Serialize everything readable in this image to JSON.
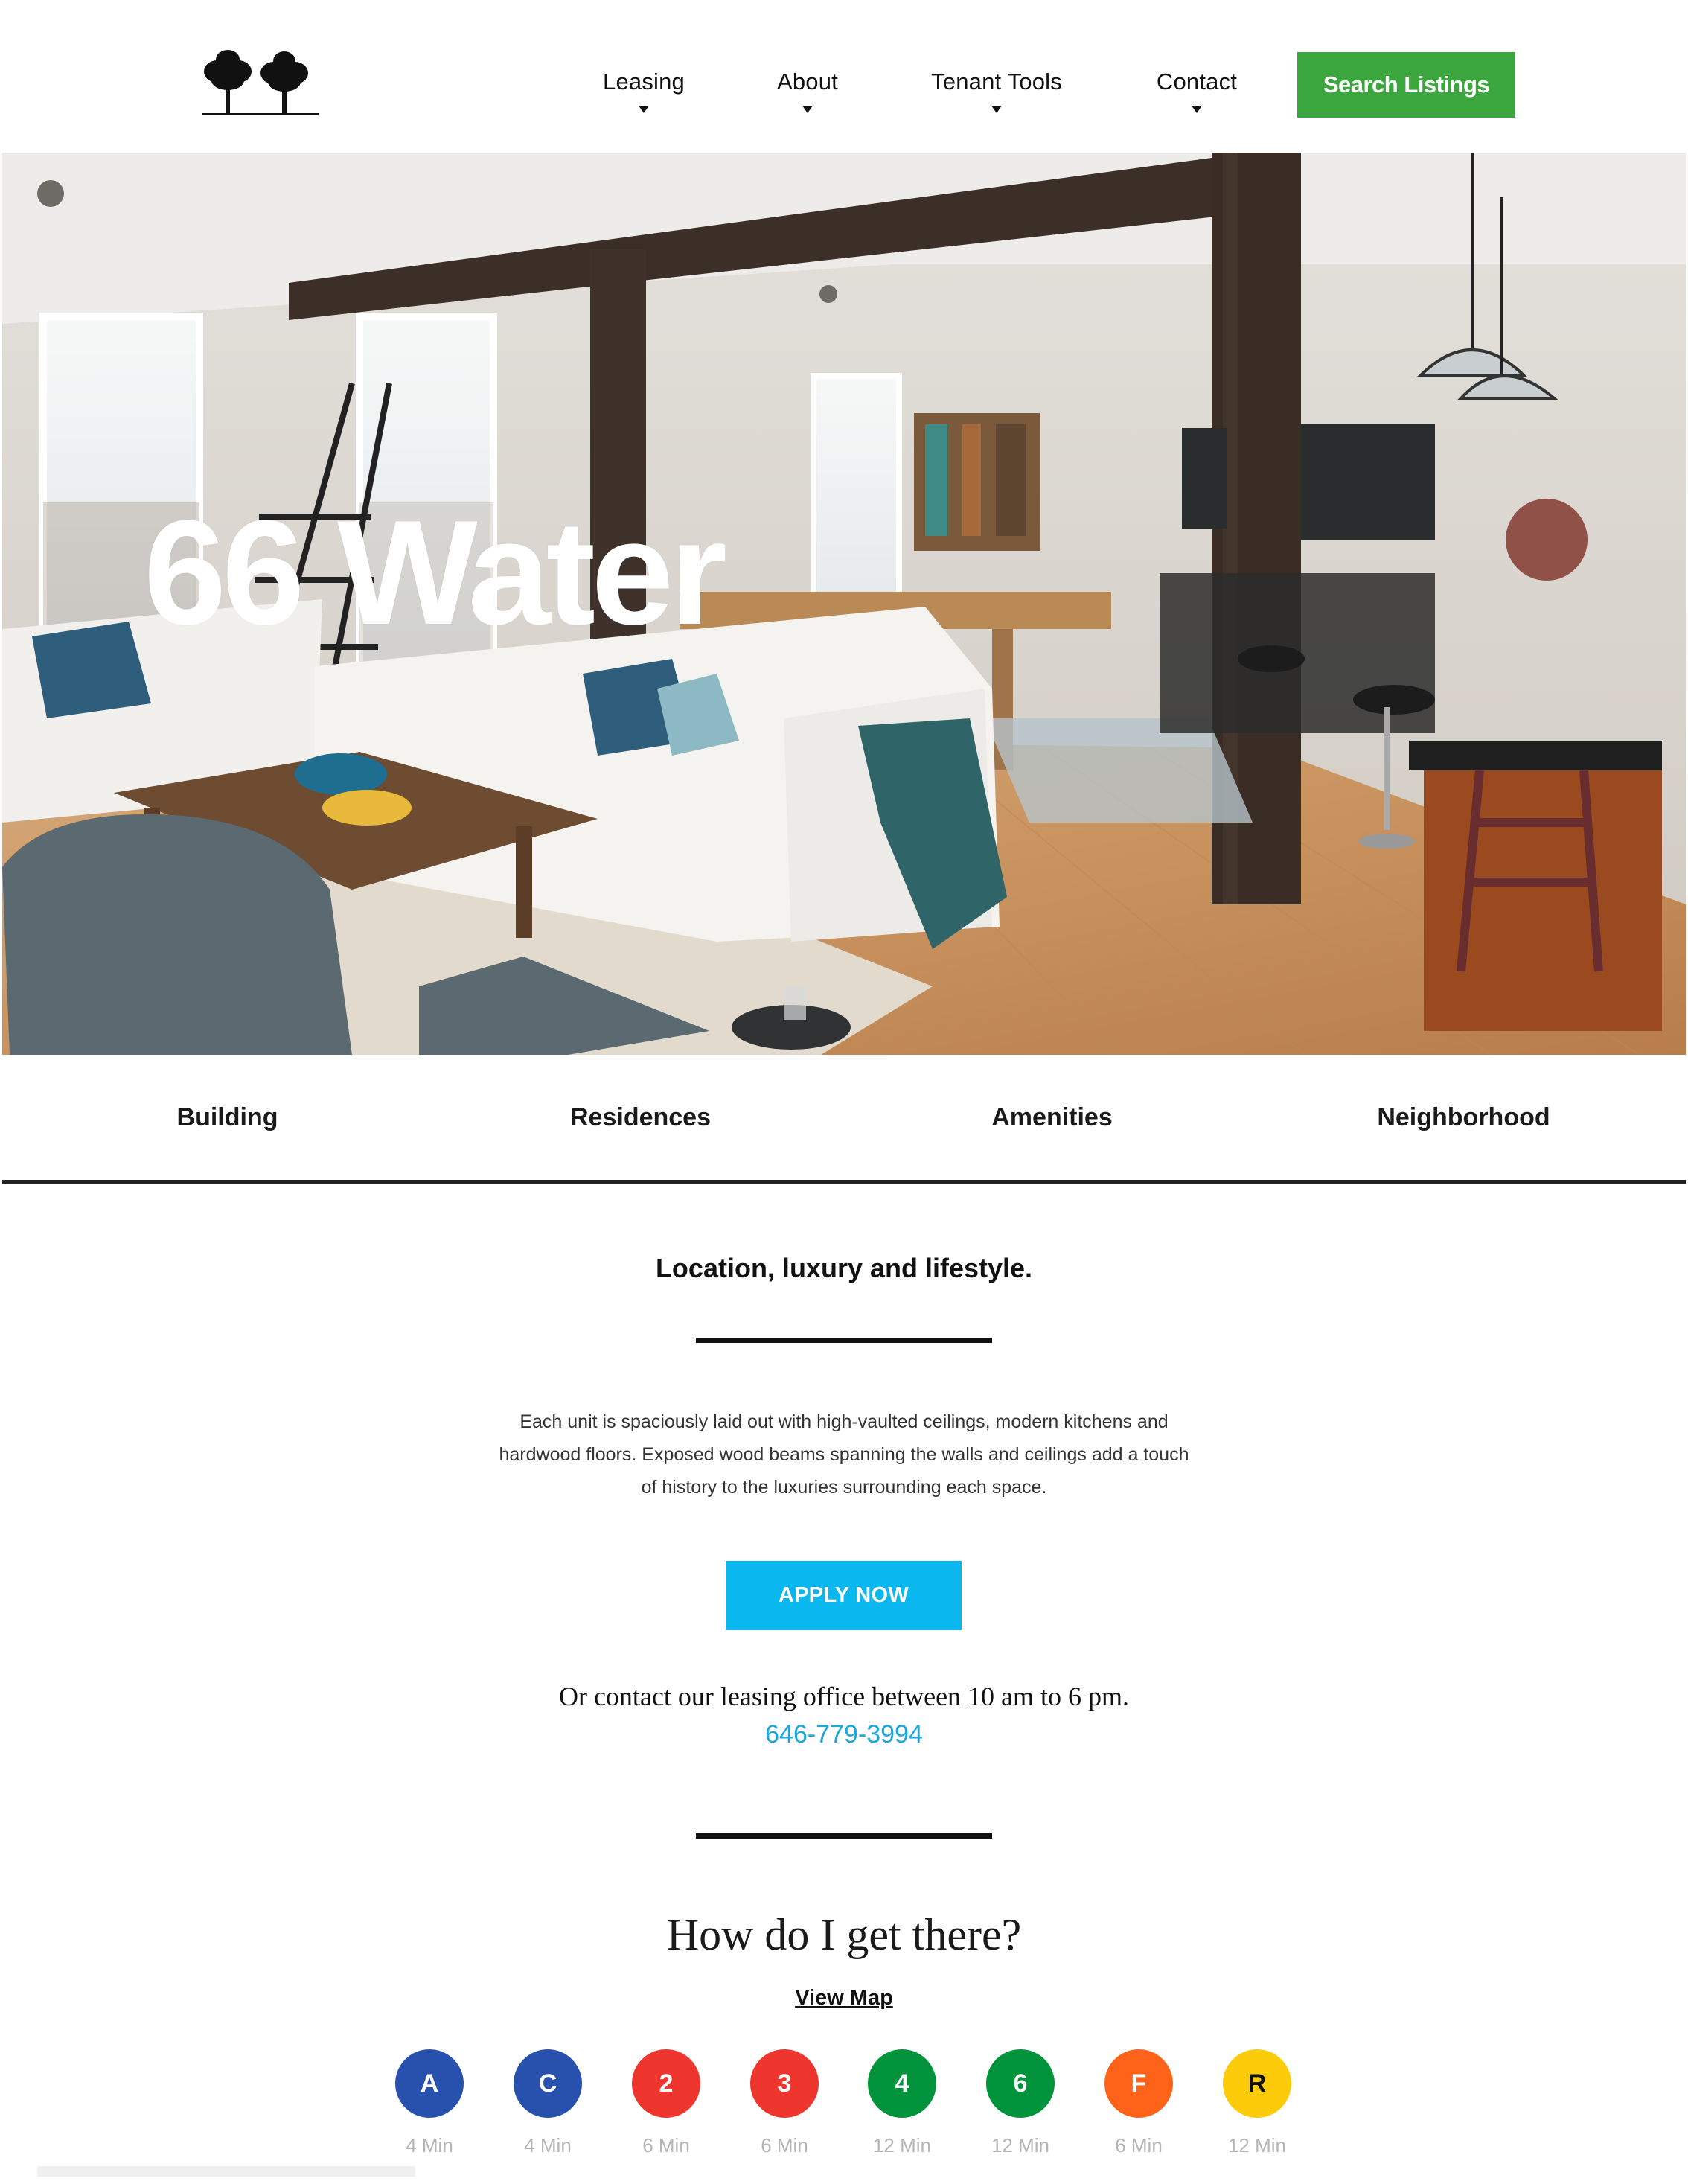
{
  "header": {
    "logo_icon": "two-trees-logo",
    "nav": [
      {
        "label": "Leasing"
      },
      {
        "label": "About"
      },
      {
        "label": "Tenant Tools"
      },
      {
        "label": "Contact"
      }
    ],
    "search_label": "Search Listings",
    "search_color": "#3ba63e"
  },
  "hero": {
    "title": "66 Water"
  },
  "tabs": [
    {
      "label": "Building"
    },
    {
      "label": "Residences"
    },
    {
      "label": "Amenities"
    },
    {
      "label": "Neighborhood"
    }
  ],
  "intro": {
    "tagline": "Location, luxury and lifestyle.",
    "description": "Each unit is spaciously laid out with high-vaulted ceilings, modern kitchens and hardwood floors. Exposed wood beams spanning the walls and ceilings add a touch of history to the luxuries surrounding each space.",
    "apply_label": "APPLY NOW",
    "apply_color": "#0bb7ef",
    "contact_text": "Or contact our leasing office between 10 am to 6 pm.",
    "phone": "646-779-3994"
  },
  "transit": {
    "title": "How do I get there?",
    "view_map_label": "View Map",
    "trains": [
      {
        "line": "A",
        "time": "4 Min",
        "color": "#2850ad",
        "text_color": "#ffffff"
      },
      {
        "line": "C",
        "time": "4 Min",
        "color": "#2850ad",
        "text_color": "#ffffff"
      },
      {
        "line": "2",
        "time": "6 Min",
        "color": "#ee352e",
        "text_color": "#ffffff"
      },
      {
        "line": "3",
        "time": "6 Min",
        "color": "#ee352e",
        "text_color": "#ffffff"
      },
      {
        "line": "4",
        "time": "12 Min",
        "color": "#00933c",
        "text_color": "#ffffff"
      },
      {
        "line": "6",
        "time": "12 Min",
        "color": "#00933c",
        "text_color": "#ffffff"
      },
      {
        "line": "F",
        "time": "6 Min",
        "color": "#ff6319",
        "text_color": "#ffffff"
      },
      {
        "line": "R",
        "time": "12 Min",
        "color": "#fccc0a",
        "text_color": "#111111"
      }
    ]
  }
}
